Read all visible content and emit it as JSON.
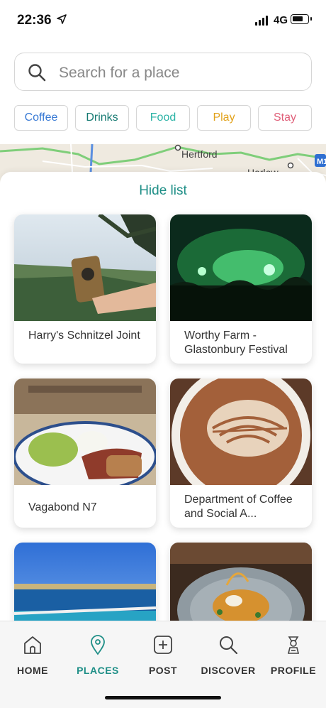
{
  "status_bar": {
    "time": "22:36",
    "network": "4G",
    "icons": [
      "location-arrow-icon",
      "signal-icon",
      "battery-icon"
    ]
  },
  "search": {
    "placeholder": "Search for a place",
    "icon": "search-icon"
  },
  "chips": [
    {
      "label": "Coffee",
      "color": "#3a7bd5"
    },
    {
      "label": "Drinks",
      "color": "#167a72"
    },
    {
      "label": "Food",
      "color": "#2bb3a6"
    },
    {
      "label": "Play",
      "color": "#e2a21b"
    },
    {
      "label": "Stay",
      "color": "#e0607a"
    }
  ],
  "map": {
    "towns": [
      "Hertford",
      "Harlow"
    ]
  },
  "sheet": {
    "hide_list_label": "Hide list"
  },
  "places": [
    {
      "title": "Harry's Schnitzel Joint"
    },
    {
      "title": "Worthy Farm - Glastonbury Festival"
    },
    {
      "title": "Vagabond N7"
    },
    {
      "title": "Department of Coffee and Social A..."
    },
    {
      "title": ""
    },
    {
      "title": ""
    }
  ],
  "tabs": [
    {
      "label": "HOME",
      "icon": "home-icon"
    },
    {
      "label": "PLACES",
      "icon": "pin-icon",
      "active": true
    },
    {
      "label": "POST",
      "icon": "plus-box-icon"
    },
    {
      "label": "DISCOVER",
      "icon": "search-icon"
    },
    {
      "label": "PROFILE",
      "icon": "profile-icon"
    }
  ],
  "colors": {
    "accent": "#1f8f87"
  }
}
